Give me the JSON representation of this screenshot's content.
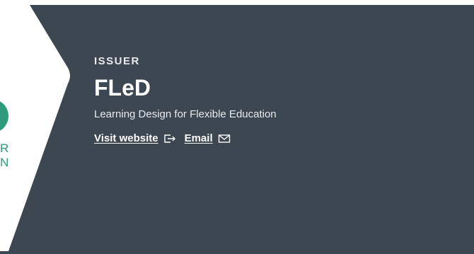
{
  "issuer": {
    "eyebrow": "ISSUER",
    "name": "FLeD",
    "description": "Learning Design for Flexible Education",
    "links": {
      "website_label": "Visit website",
      "website_icon": "external-link-icon",
      "email_label": "Email",
      "email_icon": "envelope-icon"
    }
  },
  "badge": {
    "visible_letters": [
      "R",
      "N"
    ]
  },
  "colors": {
    "panel_background": "#3d4752",
    "badge_accent": "#2f9a7c",
    "card_background": "#ffffff"
  }
}
